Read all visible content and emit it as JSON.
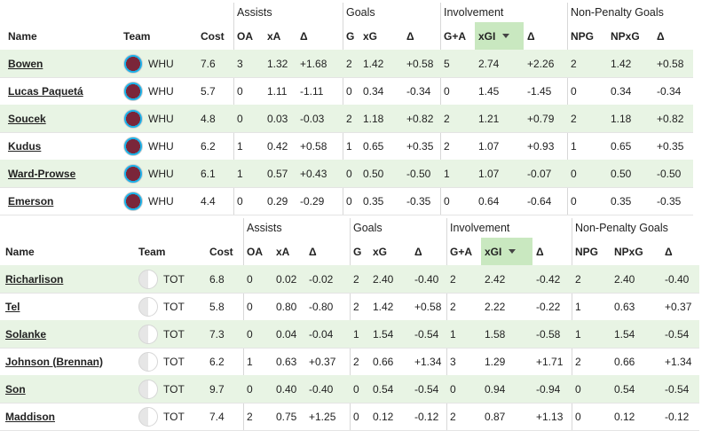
{
  "groups": {
    "assists": "Assists",
    "goals": "Goals",
    "involvement": "Involvement",
    "npg": "Non-Penalty Goals"
  },
  "columns": [
    "Name",
    "Team",
    "Cost",
    "OA",
    "xA",
    "Δ",
    "G",
    "xG",
    "Δ",
    "G+A",
    "xGI",
    "Δ",
    "NPG",
    "NPxG",
    "Δ"
  ],
  "sort_column": "xGI",
  "team_icons": {
    "WHU": "claret-and-blue-crest-icon",
    "TOT": "white-crest-icon"
  },
  "whu_players": [
    {
      "name": "Bowen",
      "team": "WHU",
      "cost": "7.6",
      "oa": "3",
      "xa": "1.32",
      "da": "+1.68",
      "g": "2",
      "xg": "1.42",
      "dg": "+0.58",
      "ga": "5",
      "xgi": "2.74",
      "di": "+2.26",
      "npg": "2",
      "npxg": "1.42",
      "dnp": "+0.58"
    },
    {
      "name": "Lucas Paquetá",
      "team": "WHU",
      "cost": "5.7",
      "oa": "0",
      "xa": "1.11",
      "da": "-1.11",
      "g": "0",
      "xg": "0.34",
      "dg": "-0.34",
      "ga": "0",
      "xgi": "1.45",
      "di": "-1.45",
      "npg": "0",
      "npxg": "0.34",
      "dnp": "-0.34"
    },
    {
      "name": "Soucek",
      "team": "WHU",
      "cost": "4.8",
      "oa": "0",
      "xa": "0.03",
      "da": "-0.03",
      "g": "2",
      "xg": "1.18",
      "dg": "+0.82",
      "ga": "2",
      "xgi": "1.21",
      "di": "+0.79",
      "npg": "2",
      "npxg": "1.18",
      "dnp": "+0.82"
    },
    {
      "name": "Kudus",
      "team": "WHU",
      "cost": "6.2",
      "oa": "1",
      "xa": "0.42",
      "da": "+0.58",
      "g": "1",
      "xg": "0.65",
      "dg": "+0.35",
      "ga": "2",
      "xgi": "1.07",
      "di": "+0.93",
      "npg": "1",
      "npxg": "0.65",
      "dnp": "+0.35"
    },
    {
      "name": "Ward-Prowse",
      "team": "WHU",
      "cost": "6.1",
      "oa": "1",
      "xa": "0.57",
      "da": "+0.43",
      "g": "0",
      "xg": "0.50",
      "dg": "-0.50",
      "ga": "1",
      "xgi": "1.07",
      "di": "-0.07",
      "npg": "0",
      "npxg": "0.50",
      "dnp": "-0.50"
    },
    {
      "name": "Emerson",
      "team": "WHU",
      "cost": "4.4",
      "oa": "0",
      "xa": "0.29",
      "da": "-0.29",
      "g": "0",
      "xg": "0.35",
      "dg": "-0.35",
      "ga": "0",
      "xgi": "0.64",
      "di": "-0.64",
      "npg": "0",
      "npxg": "0.35",
      "dnp": "-0.35"
    }
  ],
  "tot_players": [
    {
      "name": "Richarlison",
      "team": "TOT",
      "cost": "6.8",
      "oa": "0",
      "xa": "0.02",
      "da": "-0.02",
      "g": "2",
      "xg": "2.40",
      "dg": "-0.40",
      "ga": "2",
      "xgi": "2.42",
      "di": "-0.42",
      "npg": "2",
      "npxg": "2.40",
      "dnp": "-0.40"
    },
    {
      "name": "Tel",
      "team": "TOT",
      "cost": "5.8",
      "oa": "0",
      "xa": "0.80",
      "da": "-0.80",
      "g": "2",
      "xg": "1.42",
      "dg": "+0.58",
      "ga": "2",
      "xgi": "2.22",
      "di": "-0.22",
      "npg": "1",
      "npxg": "0.63",
      "dnp": "+0.37"
    },
    {
      "name": "Solanke",
      "team": "TOT",
      "cost": "7.3",
      "oa": "0",
      "xa": "0.04",
      "da": "-0.04",
      "g": "1",
      "xg": "1.54",
      "dg": "-0.54",
      "ga": "1",
      "xgi": "1.58",
      "di": "-0.58",
      "npg": "1",
      "npxg": "1.54",
      "dnp": "-0.54"
    },
    {
      "name": "Johnson (Brennan)",
      "team": "TOT",
      "cost": "6.2",
      "oa": "1",
      "xa": "0.63",
      "da": "+0.37",
      "g": "2",
      "xg": "0.66",
      "dg": "+1.34",
      "ga": "3",
      "xgi": "1.29",
      "di": "+1.71",
      "npg": "2",
      "npxg": "0.66",
      "dnp": "+1.34"
    },
    {
      "name": "Son",
      "team": "TOT",
      "cost": "9.7",
      "oa": "0",
      "xa": "0.40",
      "da": "-0.40",
      "g": "0",
      "xg": "0.54",
      "dg": "-0.54",
      "ga": "0",
      "xgi": "0.94",
      "di": "-0.94",
      "npg": "0",
      "npxg": "0.54",
      "dnp": "-0.54"
    },
    {
      "name": "Maddison",
      "team": "TOT",
      "cost": "7.4",
      "oa": "2",
      "xa": "0.75",
      "da": "+1.25",
      "g": "0",
      "xg": "0.12",
      "dg": "-0.12",
      "ga": "2",
      "xgi": "0.87",
      "di": "+1.13",
      "npg": "0",
      "npxg": "0.12",
      "dnp": "-0.12"
    }
  ]
}
